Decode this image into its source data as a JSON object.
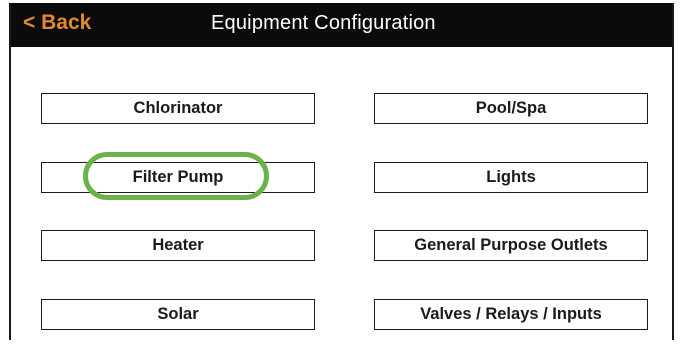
{
  "header": {
    "back_label": "< Back",
    "title": "Equipment Configuration"
  },
  "buttons": {
    "left": [
      "Chlorinator",
      "Filter Pump",
      "Heater",
      "Solar"
    ],
    "right": [
      "Pool/Spa",
      "Lights",
      "General Purpose Outlets",
      "Valves / Relays / Inputs"
    ]
  },
  "highlight": {
    "target": "Filter Pump",
    "color": "#6bb24a"
  },
  "colors": {
    "back_accent": "#e08a2c",
    "header_bg": "#0b0b0b",
    "border": "#1c1c1c"
  }
}
